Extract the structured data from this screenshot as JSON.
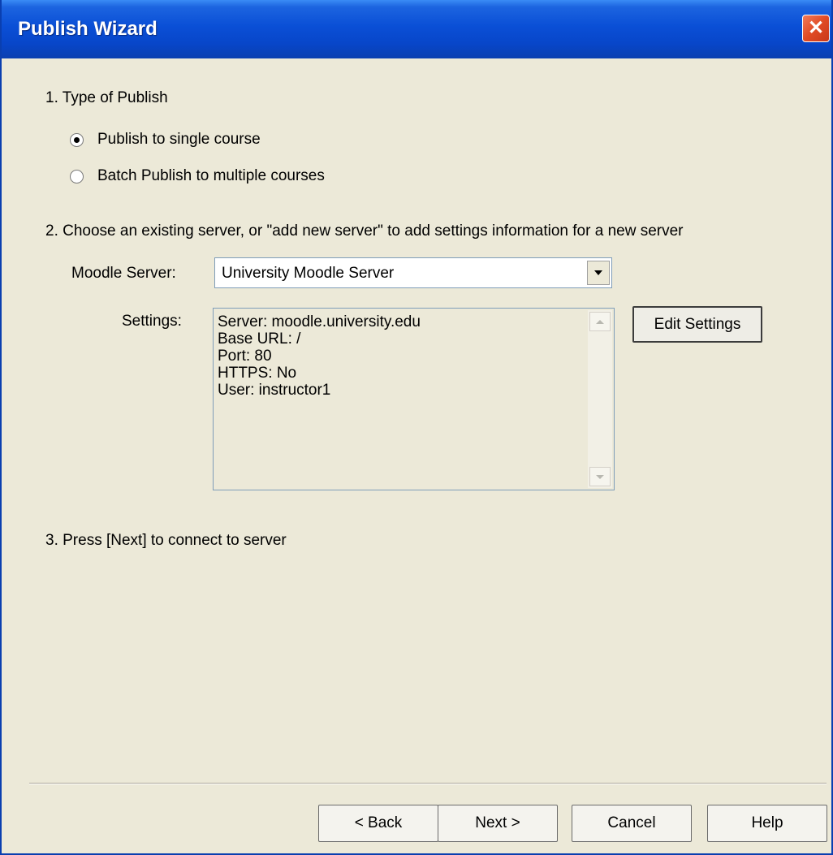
{
  "window": {
    "title": "Publish Wizard",
    "close_symbol": "✕"
  },
  "step1": {
    "heading": "1.  Type of Publish",
    "options": [
      {
        "label": "Publish to single course",
        "selected": true
      },
      {
        "label": "Batch Publish to multiple courses",
        "selected": false
      }
    ]
  },
  "step2": {
    "heading": "2.  Choose an existing server, or \"add new server\" to add settings information for a new server",
    "server_label": "Moodle Server:",
    "server_value": "University Moodle Server",
    "settings_label": "Settings:",
    "settings_lines": [
      "Server: moodle.university.edu",
      "Base URL: /",
      "Port: 80",
      "HTTPS: No",
      "User: instructor1"
    ],
    "edit_button": "Edit Settings"
  },
  "step3": {
    "heading": "3.  Press [Next] to connect to server"
  },
  "buttons": {
    "back": "< Back",
    "next": "Next >",
    "cancel": "Cancel",
    "help": "Help"
  },
  "icons": {
    "close": "close-icon",
    "dropdown": "chevron-down-icon",
    "scroll_up": "scroll-up-icon",
    "scroll_down": "scroll-down-icon"
  }
}
